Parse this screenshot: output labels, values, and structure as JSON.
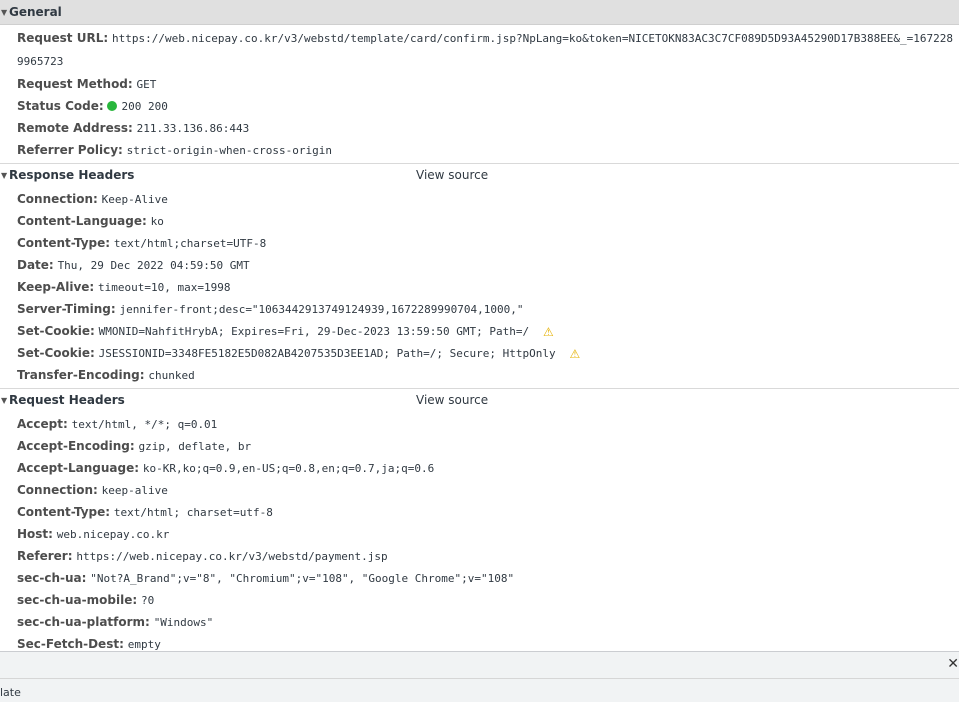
{
  "general": {
    "title": "General",
    "request_url_label": "Request URL:",
    "request_url": "https://web.nicepay.co.kr/v3/webstd/template/card/confirm.jsp?NpLang=ko&token=NICETOKN83AC3C7CF089D5D93A45290D17B388EE&_=1672289965723",
    "request_method_label": "Request Method:",
    "request_method": "GET",
    "status_code_label": "Status Code:",
    "status_code": "200 200",
    "remote_address_label": "Remote Address:",
    "remote_address": "211.33.136.86:443",
    "referrer_policy_label": "Referrer Policy:",
    "referrer_policy": "strict-origin-when-cross-origin"
  },
  "response_headers": {
    "title": "Response Headers",
    "view_source": "View source",
    "items": [
      {
        "key": "Connection:",
        "value": "Keep-Alive"
      },
      {
        "key": "Content-Language:",
        "value": "ko"
      },
      {
        "key": "Content-Type:",
        "value": "text/html;charset=UTF-8"
      },
      {
        "key": "Date:",
        "value": "Thu, 29 Dec 2022 04:59:50 GMT"
      },
      {
        "key": "Keep-Alive:",
        "value": "timeout=10, max=1998"
      },
      {
        "key": "Server-Timing:",
        "value": "jennifer-front;desc=\"1063442913749124939,1672289990704,1000,\""
      },
      {
        "key": "Set-Cookie:",
        "value": "WMONID=NahfitHrybA; Expires=Fri, 29-Dec-2023 13:59:50 GMT; Path=/"
      },
      {
        "key": "Set-Cookie:",
        "value": "JSESSIONID=3348FE5182E5D082AB4207535D3EE1AD; Path=/; Secure; HttpOnly"
      },
      {
        "key": "Transfer-Encoding:",
        "value": "chunked"
      }
    ]
  },
  "request_headers": {
    "title": "Request Headers",
    "view_source": "View source",
    "items": [
      {
        "key": "Accept:",
        "value": "text/html, */*; q=0.01"
      },
      {
        "key": "Accept-Encoding:",
        "value": "gzip, deflate, br"
      },
      {
        "key": "Accept-Language:",
        "value": "ko-KR,ko;q=0.9,en-US;q=0.8,en;q=0.7,ja;q=0.6"
      },
      {
        "key": "Connection:",
        "value": "keep-alive"
      },
      {
        "key": "Content-Type:",
        "value": "text/html; charset=utf-8"
      },
      {
        "key": "Host:",
        "value": "web.nicepay.co.kr"
      },
      {
        "key": "Referer:",
        "value": "https://web.nicepay.co.kr/v3/webstd/payment.jsp"
      },
      {
        "key": "sec-ch-ua:",
        "value": "\"Not?A_Brand\";v=\"8\", \"Chromium\";v=\"108\", \"Google Chrome\";v=\"108\""
      },
      {
        "key": "sec-ch-ua-mobile:",
        "value": "?0"
      },
      {
        "key": "sec-ch-ua-platform:",
        "value": "\"Windows\""
      },
      {
        "key": "Sec-Fetch-Dest:",
        "value": "empty"
      }
    ]
  },
  "drawer": {
    "close_glyph": "✕",
    "status_text": "late"
  },
  "colors": {
    "status_dot": "#28b63c",
    "warning": "#e5b000"
  }
}
